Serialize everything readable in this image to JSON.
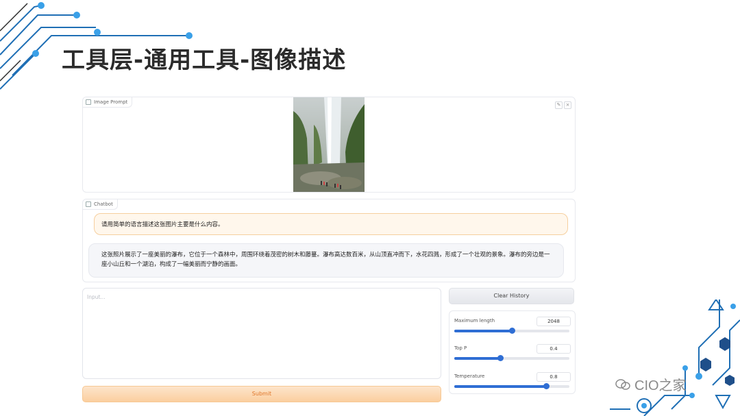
{
  "slide": {
    "title": "工具层-通用工具-图像描述",
    "watermark": "CIO之家"
  },
  "image_prompt": {
    "label": "Image Prompt",
    "edit_icon": "pencil-icon",
    "clear_icon": "close-icon"
  },
  "chatbot": {
    "label": "Chatbot",
    "user_message": "请用简单的语言描述这张图片主要是什么内容。",
    "bot_message": "这张照片展示了一座美丽的瀑布，它位于一个森林中，周围环绕着茂密的树木和藤蔓。瀑布高达数百米，从山顶直冲而下，水花四溅，形成了一个壮观的景象。瀑布的旁边是一座小山丘和一个湖泊，构成了一幅美丽而宁静的画面。"
  },
  "input": {
    "placeholder": "Input..."
  },
  "buttons": {
    "submit": "Submit",
    "clear_history": "Clear History"
  },
  "params": [
    {
      "label": "Maximum length",
      "value": "2048",
      "fraction": 0.5
    },
    {
      "label": "Top P",
      "value": "0.4",
      "fraction": 0.4
    },
    {
      "label": "Temperature",
      "value": "0.8",
      "fraction": 0.8
    }
  ],
  "colors": {
    "accent": "#2f6ed4",
    "submit_text": "#e0762a",
    "user_bubble": "#fff7ec"
  }
}
